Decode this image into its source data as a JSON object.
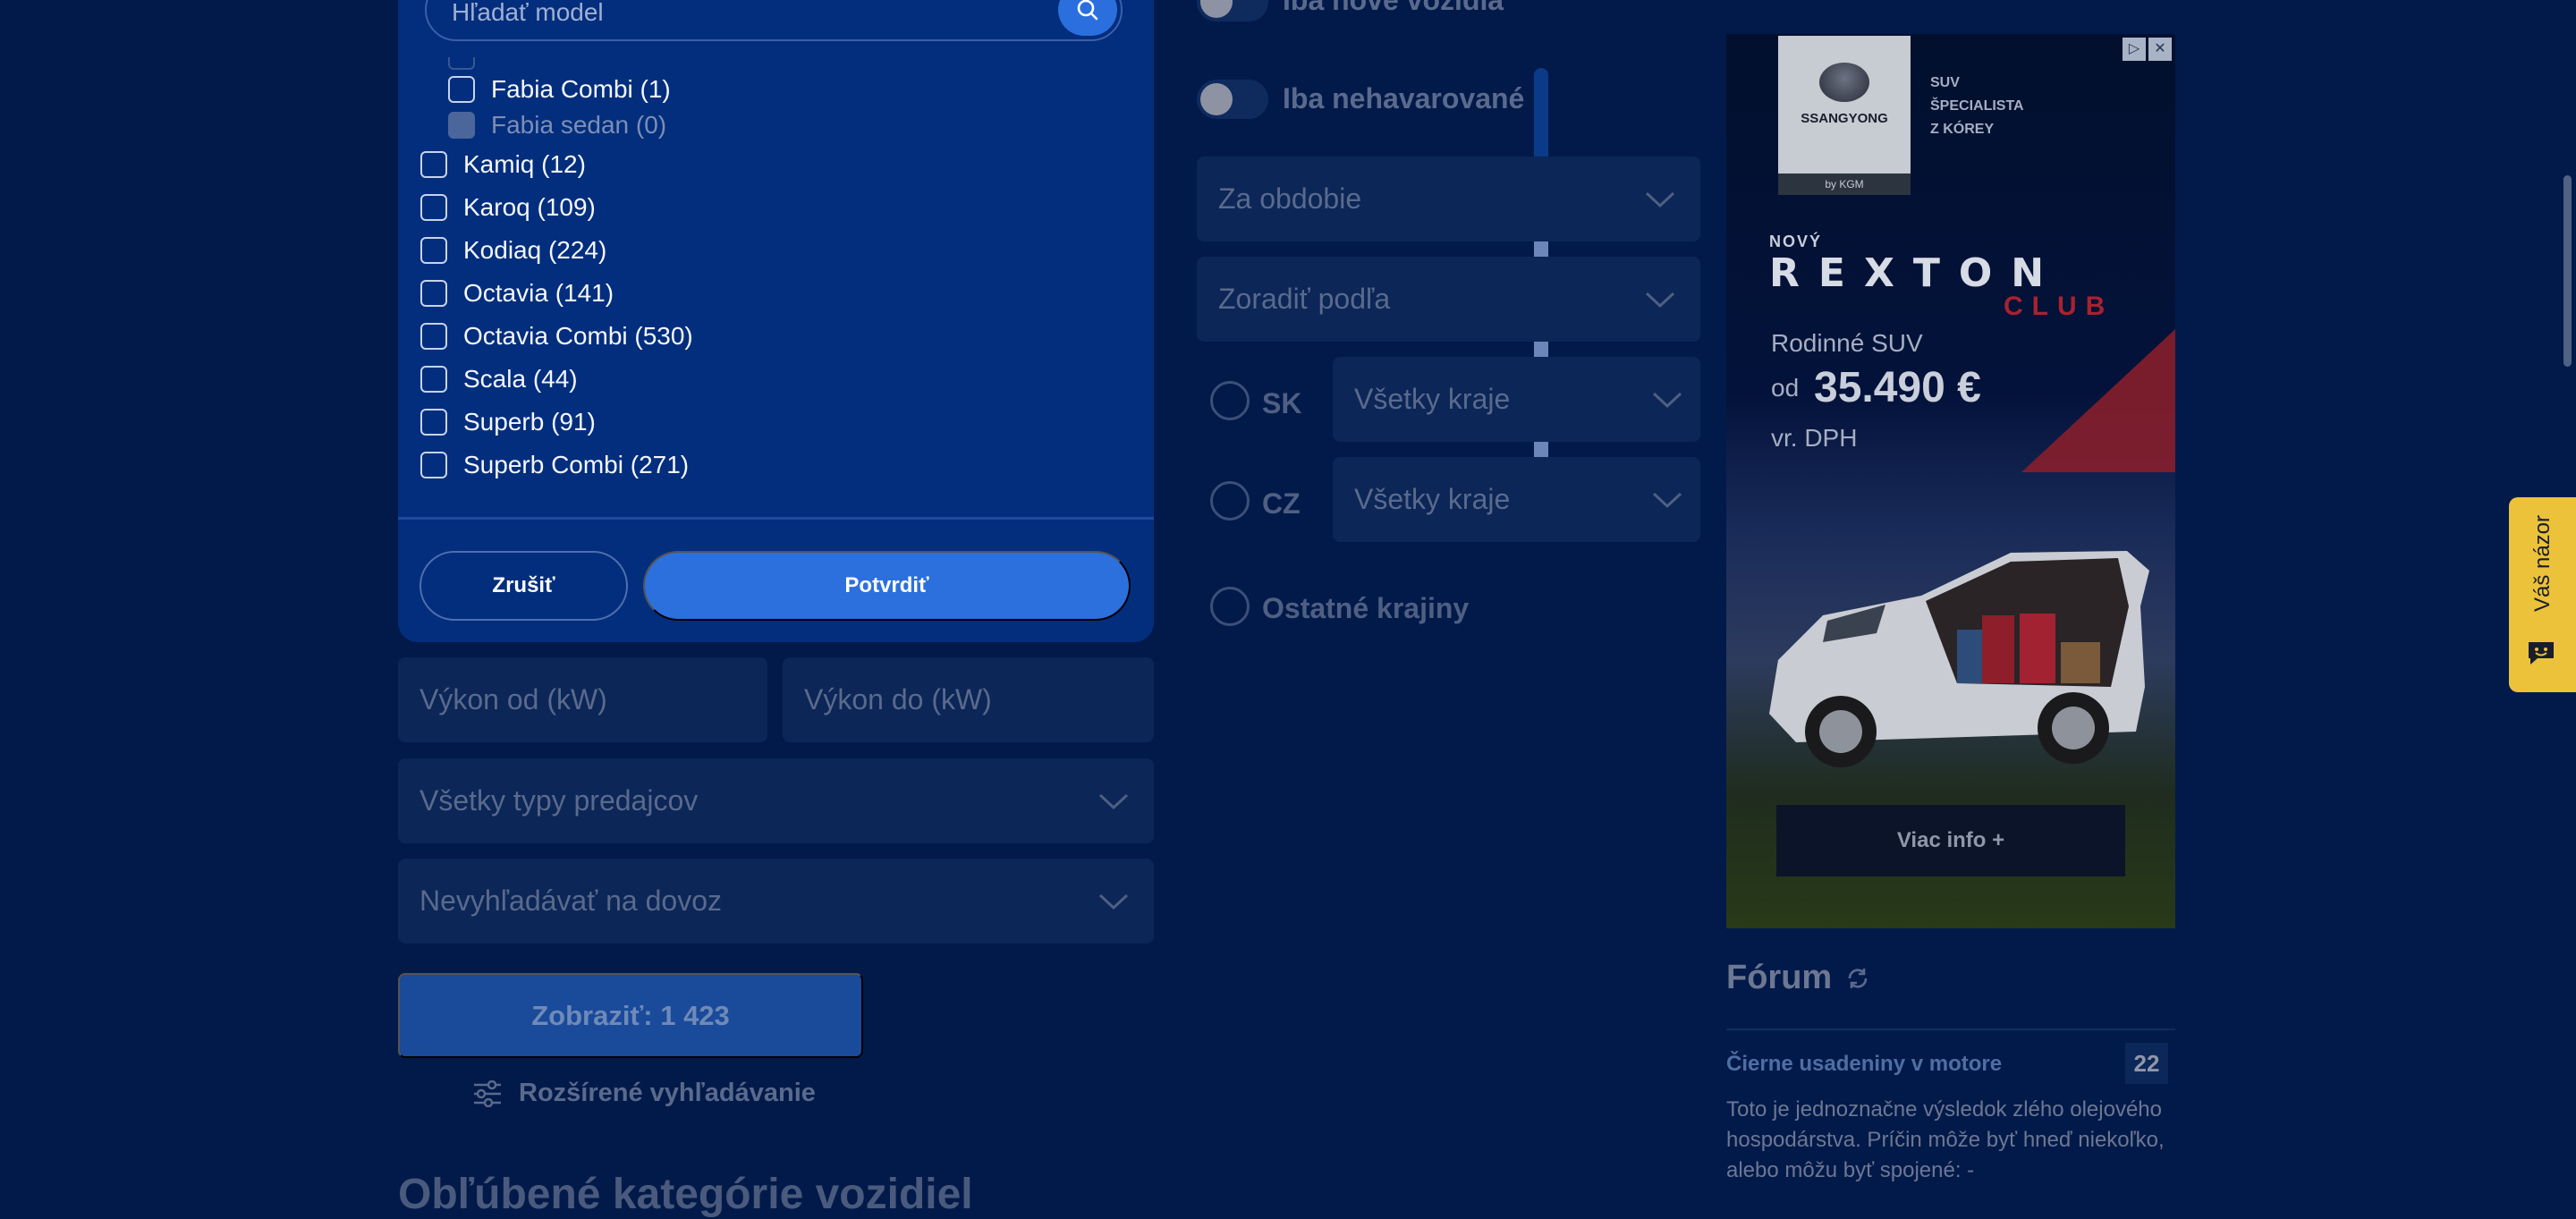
{
  "model_picker": {
    "search_placeholder": "Hľadať model",
    "items": [
      {
        "label": "Fabia Combi (1)",
        "level": "sub",
        "disabled": false
      },
      {
        "label": "Fabia sedan (0)",
        "level": "sub",
        "disabled": true
      },
      {
        "label": "Kamiq (12)",
        "level": "top",
        "disabled": false
      },
      {
        "label": "Karoq (109)",
        "level": "top",
        "disabled": false
      },
      {
        "label": "Kodiaq (224)",
        "level": "top",
        "disabled": false
      },
      {
        "label": "Octavia (141)",
        "level": "top",
        "disabled": false
      },
      {
        "label": "Octavia Combi (530)",
        "level": "top",
        "disabled": false
      },
      {
        "label": "Scala (44)",
        "level": "top",
        "disabled": false
      },
      {
        "label": "Superb (91)",
        "level": "top",
        "disabled": false
      },
      {
        "label": "Superb Combi (271)",
        "level": "top",
        "disabled": false
      }
    ],
    "cancel_label": "Zrušiť",
    "confirm_label": "Potvrdiť"
  },
  "filters": {
    "power_from": "Výkon od (kW)",
    "power_to": "Výkon do (kW)",
    "dealer_types": "Všetky typy predajcov",
    "import": "Nevyhľadávať na dovoz",
    "show_button": "Zobraziť: 1 423",
    "advanced_link": "Rozšírené vyhľadávanie",
    "cut_heading": "Obľúbené kategórie vozidiel"
  },
  "options": {
    "new_only": "Iba nové vozidlá",
    "not_crashed": "Iba nehavarované",
    "period": "Za obdobie",
    "sort_by": "Zoradiť podľa",
    "country_sk": "SK",
    "country_cz": "CZ",
    "regions_sk": "Všetky kraje",
    "regions_cz": "Všetky kraje",
    "other_countries": "Ostatné krajiny"
  },
  "ad": {
    "brand": "SSANGYONG",
    "brand_sub": "by KGM",
    "tagline": [
      "SUV",
      "ŠPECIALISTA",
      "Z KÓREY"
    ],
    "novy": "NOVÝ",
    "model": "REXTON",
    "model_sub": "CLUB",
    "suv": "Rodinné SUV",
    "od": "od",
    "price": "35.490 €",
    "vat": "vr. DPH",
    "more": "Viac info  +"
  },
  "forum": {
    "title": "Fórum",
    "topic": "Čierne usadeniny v motore",
    "count": "22",
    "excerpt": "Toto je jednoznačne výsledok zlého olejového hospodárstva. Príčin môže byť hneď niekoľko, alebo môžu byť spojené: -"
  },
  "feedback": {
    "label": "Váš názor"
  }
}
